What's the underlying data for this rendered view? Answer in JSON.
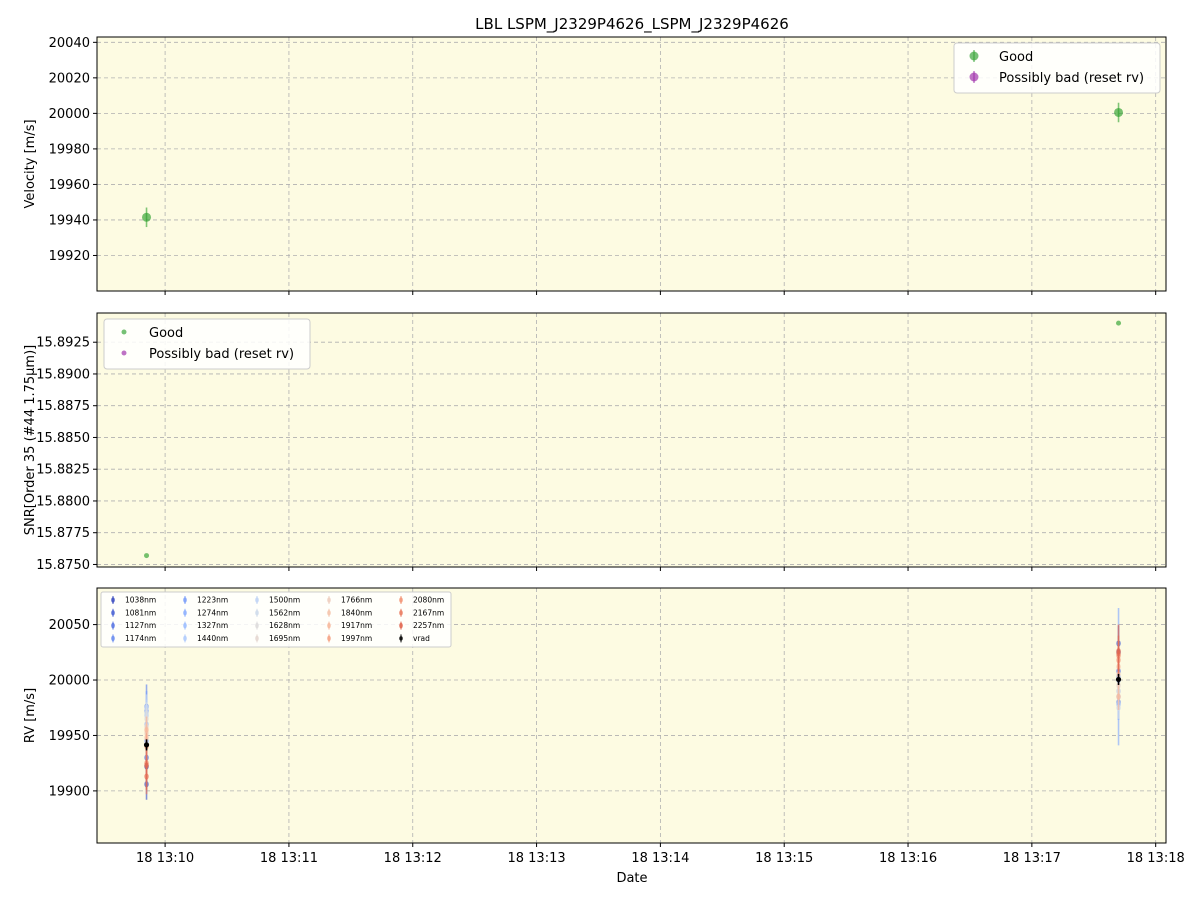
{
  "chart_data": {
    "title": "LBL LSPM_J2329P4626_LSPM_J2329P4626",
    "xlabel": "Date",
    "xlim": [
      "13:09:27",
      "13:18:05"
    ],
    "xticks": [
      {
        "t": "13:10:00",
        "label": "18 13:10"
      },
      {
        "t": "13:11:00",
        "label": "18 13:11"
      },
      {
        "t": "13:12:00",
        "label": "18 13:12"
      },
      {
        "t": "13:13:00",
        "label": "18 13:13"
      },
      {
        "t": "13:14:00",
        "label": "18 13:14"
      },
      {
        "t": "13:15:00",
        "label": "18 13:15"
      },
      {
        "t": "13:16:00",
        "label": "18 13:16"
      },
      {
        "t": "13:17:00",
        "label": "18 13:17"
      },
      {
        "t": "13:18:00",
        "label": "18 13:18"
      }
    ],
    "background": "#fdfbe2",
    "grid": true,
    "colors": {
      "good": "#2ca02c",
      "bad": "#9b27a8"
    },
    "panels": [
      {
        "type": "scatter",
        "ylabel": "Velocity [m/s]",
        "ylim": [
          19900,
          20043
        ],
        "yticks": [
          19920,
          19940,
          19960,
          19980,
          20000,
          20020,
          20040
        ],
        "legend": {
          "position": "top-right",
          "entries": [
            "Good",
            "Possibly bad (reset rv)"
          ]
        },
        "series": [
          {
            "name": "Good",
            "points": [
              {
                "t": "13:09:51",
                "y": 19941.5,
                "err": 5.5
              },
              {
                "t": "13:17:42",
                "y": 20000.5,
                "err": 5.5
              }
            ]
          },
          {
            "name": "Possibly bad (reset rv)",
            "points": []
          }
        ]
      },
      {
        "type": "scatter",
        "ylabel": "SNR[Order 35 (#44 1.75μm)]",
        "ylim": [
          15.8748,
          15.8948
        ],
        "yticks": [
          15.875,
          15.8775,
          15.88,
          15.8825,
          15.885,
          15.8875,
          15.89,
          15.8925
        ],
        "legend": {
          "position": "top-left",
          "entries": [
            "Good",
            "Possibly bad (reset rv)"
          ]
        },
        "series": [
          {
            "name": "Good",
            "points": [
              {
                "t": "13:09:51",
                "y": 15.8757
              },
              {
                "t": "13:17:42",
                "y": 15.894
              }
            ]
          },
          {
            "name": "Possibly bad (reset rv)",
            "points": []
          }
        ]
      },
      {
        "type": "scatter",
        "ylabel": "RV [m/s]",
        "ylim": [
          19853,
          20083
        ],
        "yticks": [
          19900,
          19950,
          20000,
          20050
        ],
        "legend": {
          "position": "top-left",
          "columns": 5
        },
        "series": [
          {
            "name": "1038nm",
            "color": "#3b4cc0",
            "points": [
              {
                "t": "13:09:51",
                "y": 19922,
                "err": 15
              },
              {
                "t": "13:17:42",
                "y": 20025,
                "err": 15
              }
            ]
          },
          {
            "name": "1081nm",
            "color": "#4a63d3",
            "points": [
              {
                "t": "13:09:51",
                "y": 19906,
                "err": 14
              },
              {
                "t": "13:17:42",
                "y": 20033,
                "err": 16
              }
            ]
          },
          {
            "name": "1127nm",
            "color": "#5977e3",
            "points": [
              {
                "t": "13:09:51",
                "y": 19930,
                "err": 12
              },
              {
                "t": "13:17:42",
                "y": 20008,
                "err": 14
              }
            ]
          },
          {
            "name": "1174nm",
            "color": "#6b8df0",
            "points": [
              {
                "t": "13:09:51",
                "y": 19976,
                "err": 20
              },
              {
                "t": "13:17:42",
                "y": 19980,
                "err": 16
              }
            ]
          },
          {
            "name": "1223nm",
            "color": "#7b9ff9",
            "points": [
              {
                "t": "13:09:51",
                "y": 19972,
                "err": 18
              },
              {
                "t": "13:17:42",
                "y": 20000,
                "err": 20
              }
            ]
          },
          {
            "name": "1274nm",
            "color": "#8db0fe",
            "points": [
              {
                "t": "13:09:51",
                "y": 19945,
                "err": 38
              },
              {
                "t": "13:17:42",
                "y": 20003,
                "err": 62
              }
            ]
          },
          {
            "name": "1327nm",
            "color": "#9ebeff",
            "points": [
              {
                "t": "13:09:51",
                "y": 19960,
                "err": 16
              },
              {
                "t": "13:17:42",
                "y": 19978,
                "err": 14
              }
            ]
          },
          {
            "name": "1440nm",
            "color": "#b0cbfc",
            "points": [
              {
                "t": "13:09:51",
                "y": 19968,
                "err": 14
              },
              {
                "t": "13:17:42",
                "y": 19990,
                "err": 12
              }
            ]
          },
          {
            "name": "1500nm",
            "color": "#c0d4f5",
            "points": [
              {
                "t": "13:09:51",
                "y": 19975,
                "err": 12
              },
              {
                "t": "13:17:42",
                "y": 19985,
                "err": 10
              }
            ]
          },
          {
            "name": "1562nm",
            "color": "#cfdaea",
            "points": [
              {
                "t": "13:09:51",
                "y": 19970,
                "err": 10
              },
              {
                "t": "13:17:42",
                "y": 19975,
                "err": 10
              }
            ]
          },
          {
            "name": "1628nm",
            "color": "#dddcdc",
            "points": [
              {
                "t": "13:09:51",
                "y": 19965,
                "err": 10
              },
              {
                "t": "13:17:42",
                "y": 19990,
                "err": 10
              }
            ]
          },
          {
            "name": "1695nm",
            "color": "#e5d8d1",
            "points": [
              {
                "t": "13:09:51",
                "y": 19958,
                "err": 10
              },
              {
                "t": "13:17:42",
                "y": 19995,
                "err": 10
              }
            ]
          },
          {
            "name": "1766nm",
            "color": "#efcfbf",
            "points": [
              {
                "t": "13:09:51",
                "y": 19952,
                "err": 10
              },
              {
                "t": "13:17:42",
                "y": 20005,
                "err": 10
              }
            ]
          },
          {
            "name": "1840nm",
            "color": "#f5c4ac",
            "points": [
              {
                "t": "13:09:51",
                "y": 19948,
                "err": 10
              },
              {
                "t": "13:17:42",
                "y": 20012,
                "err": 10
              }
            ]
          },
          {
            "name": "1917nm",
            "color": "#f7b89c",
            "points": [
              {
                "t": "13:09:51",
                "y": 19955,
                "err": 12
              },
              {
                "t": "13:17:42",
                "y": 19985,
                "err": 12
              }
            ]
          },
          {
            "name": "1997nm",
            "color": "#f6a385",
            "points": [
              {
                "t": "13:09:51",
                "y": 19940,
                "err": 12
              },
              {
                "t": "13:17:42",
                "y": 20018,
                "err": 12
              }
            ]
          },
          {
            "name": "2080nm",
            "color": "#f39475",
            "points": [
              {
                "t": "13:09:51",
                "y": 19925,
                "err": 14
              },
              {
                "t": "13:17:42",
                "y": 20022,
                "err": 14
              }
            ]
          },
          {
            "name": "2167nm",
            "color": "#ea7b60",
            "points": [
              {
                "t": "13:09:51",
                "y": 19913,
                "err": 16
              },
              {
                "t": "13:17:42",
                "y": 20024,
                "err": 16
              }
            ]
          },
          {
            "name": "2257nm",
            "color": "#e0654f",
            "points": [
              {
                "t": "13:09:51",
                "y": 19923,
                "err": 22
              },
              {
                "t": "13:17:42",
                "y": 20026,
                "err": 24
              }
            ]
          },
          {
            "name": "vrad",
            "color": "#000000",
            "points": [
              {
                "t": "13:09:51",
                "y": 19941.5,
                "err": 5
              },
              {
                "t": "13:17:42",
                "y": 20000.5,
                "err": 5
              }
            ]
          }
        ]
      }
    ]
  }
}
